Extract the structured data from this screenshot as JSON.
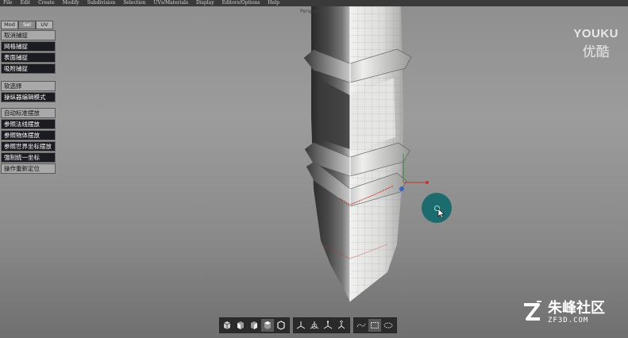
{
  "menubar": {
    "items": [
      "File",
      "Edit",
      "Create",
      "Modify",
      "Subdivision",
      "Selection",
      "UVs/Materials",
      "Display",
      "Editors/Options",
      "Help"
    ]
  },
  "viewport": {
    "label": "Perspective"
  },
  "side_panel": {
    "tabs": [
      "Mod",
      "Sel",
      "UV"
    ],
    "active_tab": "Sel",
    "group1": [
      "取消捕捉",
      "网格捕捉",
      "表面捕捉",
      "吸附捕捉"
    ],
    "group2": [
      "软选择",
      "操纵器编辑模式"
    ],
    "group3": [
      "自动标准摆放",
      "参照法线摆放",
      "参照物体摆放",
      "参照世界坐标摆放",
      "强制统一坐标",
      "操作重新定位"
    ]
  },
  "watermarks": {
    "youku_en": "YOUKU",
    "youku_cn": "优酷",
    "site_cn": "朱峰社区",
    "site_en": "ZF3D.COM"
  },
  "toolbar": {
    "view_icons": [
      "perspective-view-icon",
      "front-view-icon",
      "side-view-icon",
      "top-view-icon",
      "object-cube-icon"
    ],
    "transform_icons": [
      "move-gizmo-icon",
      "rotate-gizmo-icon",
      "scale-gizmo-icon",
      "universal-gizmo-icon"
    ],
    "select_icons": [
      "lasso-select-icon",
      "rect-select-icon",
      "paint-select-icon"
    ]
  },
  "colors": {
    "menubar": "#3a3a3a",
    "button_dark": "#1b1b22",
    "button_light": "#a9a9a9",
    "cursor_ring": "#1c6b6f"
  }
}
